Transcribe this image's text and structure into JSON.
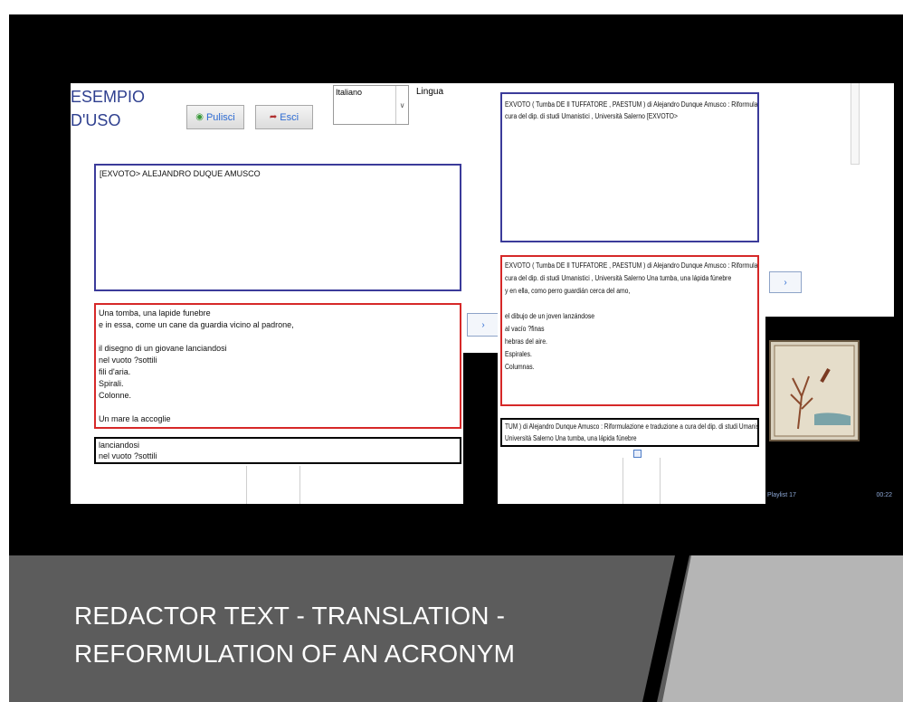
{
  "left_panel": {
    "title_line1": "ESEMPIO",
    "title_line2": "D'USO",
    "clear_button": "Pulisci",
    "exit_button": "Esci",
    "language_value": "Italiano",
    "language_label": "Lingua",
    "input_text": "[EXVOTO> ALEJANDRO DUQUE AMUSCO",
    "poem_lines": [
      "Una tomba, una lapide funebre",
      "e in essa, come un cane da guardia vicino al padrone,",
      "",
      "il disegno di un giovane lanciandosi",
      "nel vuoto ?sottili",
      "fili d'aria.",
      "Spirali.",
      "Colonne.",
      "",
      "Un mare la accoglie"
    ],
    "selection_lines": [
      "lanciandosi",
      "nel vuoto ?sottili"
    ],
    "next_button": "›"
  },
  "right_panel": {
    "acronym_lines": [
      "EXVOTO ( Tumba DE Il TUFFATORE , PAESTUM ) di Alejandro Dunque Amusco : Riformulazione e traduzione a",
      "cura del dip. di studi Umanistici , Università Salerno [EXVOTO>"
    ],
    "translation_lines": [
      "EXVOTO ( Tumba DE Il TUFFATORE , PAESTUM ) di Alejandro Dunque Amusco : Riformulazione e traduzione a",
      "cura del dip. di studi Umanistici , Università Salerno Una tumba, una lápida fúnebre",
      "y en ella, como perro guardián cerca del amo,",
      "",
      "el dibujo de un joven lanzándose",
      "al vacío ?finas",
      "hebras del aire.",
      "Espirales.",
      "Columnas."
    ],
    "result_lines": [
      "TUM ) di Alejandro Dunque Amusco : Riformulazione e traduzione a cura del dip. di studi Umanistici ,",
      "Università Salerno Una tumba, una lápida fúnebre"
    ],
    "next_button": "›",
    "video_playlist": "Playlist 17",
    "video_time": "00:22"
  },
  "caption": {
    "line1": "REDACTOR TEXT - TRANSLATION -",
    "line2": "REFORMULATION OF AN ACRONYM"
  },
  "colors": {
    "slide_background": "#000000",
    "caption_band": "#5c5c5c",
    "caption_text": "#ffffff",
    "input_border": "#3b3b9a",
    "output_border": "#d62828",
    "title_text": "#2e3f8f"
  }
}
